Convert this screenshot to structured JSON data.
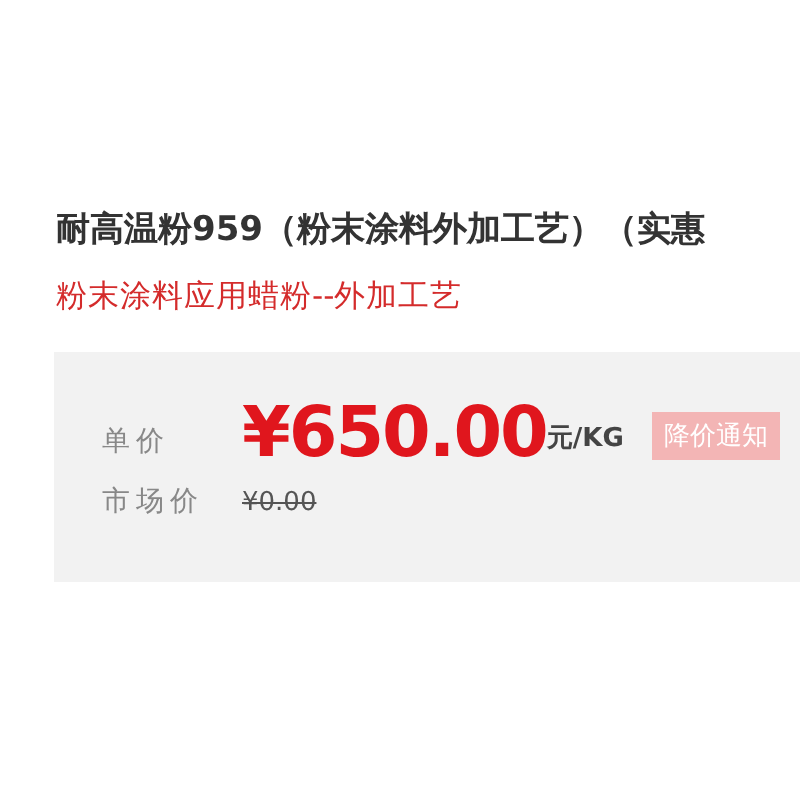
{
  "product": {
    "title": "耐高温粉959（粉末涂料外加工艺）（实惠",
    "subtitle": "粉末涂料应用蜡粉--外加工艺"
  },
  "price_panel": {
    "price_label": "单价",
    "price": "¥650.00",
    "unit": "元/KG",
    "notify_button": "降价通知",
    "market_label": "市场价",
    "market_price": "¥0.00"
  }
}
